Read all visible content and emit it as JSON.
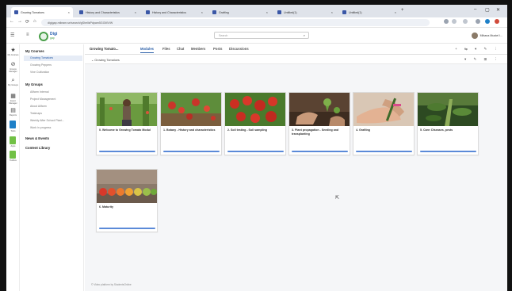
{
  "browser": {
    "tabs": [
      {
        "label": "Growing Tomatoes"
      },
      {
        "label": "History and Characteristics"
      },
      {
        "label": "History and Characteristics"
      },
      {
        "label": "Grafting"
      },
      {
        "label": "Untitled(1)"
      },
      {
        "label": "Untitled(1)"
      }
    ],
    "url": "digigap.mileam.se/search/gShellsPdpam5GGMV/W",
    "window_controls": [
      "–",
      "▢",
      "✕"
    ]
  },
  "app": {
    "logo_main": "Digi",
    "logo_sub": "gap",
    "search_placeholder": "Search",
    "user_name": "Mihana Mustel I..."
  },
  "rail": {
    "items": [
      {
        "label": "My Courses",
        "icon": "star-icon"
      },
      {
        "label": "Groups Manager",
        "icon": "tag-icon"
      },
      {
        "label": "My Groups",
        "icon": "chat-icon"
      },
      {
        "label": "Event Manager",
        "icon": "calendar-icon"
      },
      {
        "label": "Reports",
        "icon": "chart-icon"
      },
      {
        "label": "Tools",
        "icon": "app-icon"
      },
      {
        "label": "Apps",
        "icon": "app-icon"
      },
      {
        "label": "Toolbox",
        "icon": "app-icon"
      }
    ]
  },
  "sidebar": {
    "my_courses": "My Courses",
    "course_items": [
      "Growing Tomatoes",
      "Growing Peppers",
      "Vine Cultivation"
    ],
    "my_groups": "My Groups",
    "group_items": [
      "Allfarm Internal",
      "Project Management",
      "About Allfarm",
      "Testmaps",
      "Weekly After School Plant...",
      "Work in progress"
    ],
    "news": "News & Events",
    "library": "Content Library"
  },
  "course": {
    "title": "Growing Tomato...",
    "tabs": [
      "Modules",
      "Files",
      "Chat",
      "Members",
      "Posts",
      "Discussions"
    ],
    "active_tab": "Modules",
    "section_title": "Growing Tomatoes"
  },
  "modules": [
    {
      "title": "0. Welcome to Growing Tomato Modul",
      "icon": "photo-woman-greenhouse"
    },
    {
      "title": "1. Botany - History and characteristics",
      "icon": "photo-tomatoes-vine"
    },
    {
      "title": "2. Soil testing - Soil sampling",
      "icon": "photo-red-tomatoes"
    },
    {
      "title": "3. Plant propagation - Seeding and transplanting",
      "icon": "photo-hands-seedling"
    },
    {
      "title": "4. Grafting",
      "icon": "photo-grafting"
    },
    {
      "title": "5. Care: Diseases, pests",
      "icon": "photo-plant-stem"
    },
    {
      "title": "6. Maturity",
      "icon": "photo-ripening-row"
    }
  ],
  "footer_text": "© Video platform by StudentsOnline",
  "colors": {
    "accent": "#2b5fa8",
    "progress": "#5b8ad8",
    "logo_green": "#4aa04a"
  }
}
